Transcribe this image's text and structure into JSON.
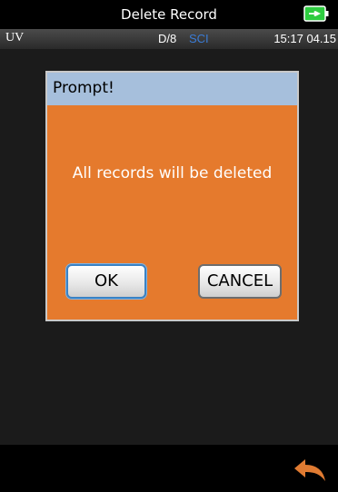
{
  "header": {
    "title": "Delete Record",
    "battery_icon": "battery-charging-icon",
    "battery_color": "#2ecc40"
  },
  "status_bar": {
    "light_source": "UV",
    "geometry": "D/8",
    "mode": "SCI",
    "mode_color": "#3a7bd5",
    "time": "15:17 04.15"
  },
  "dialog": {
    "title": "Prompt!",
    "message": "All records will be deleted",
    "ok_label": "OK",
    "cancel_label": "CANCEL",
    "body_color": "#e57a2d",
    "header_color": "#a6bfdc"
  },
  "footer": {
    "back_icon": "back-arrow-icon",
    "back_color": "#e07b32"
  }
}
